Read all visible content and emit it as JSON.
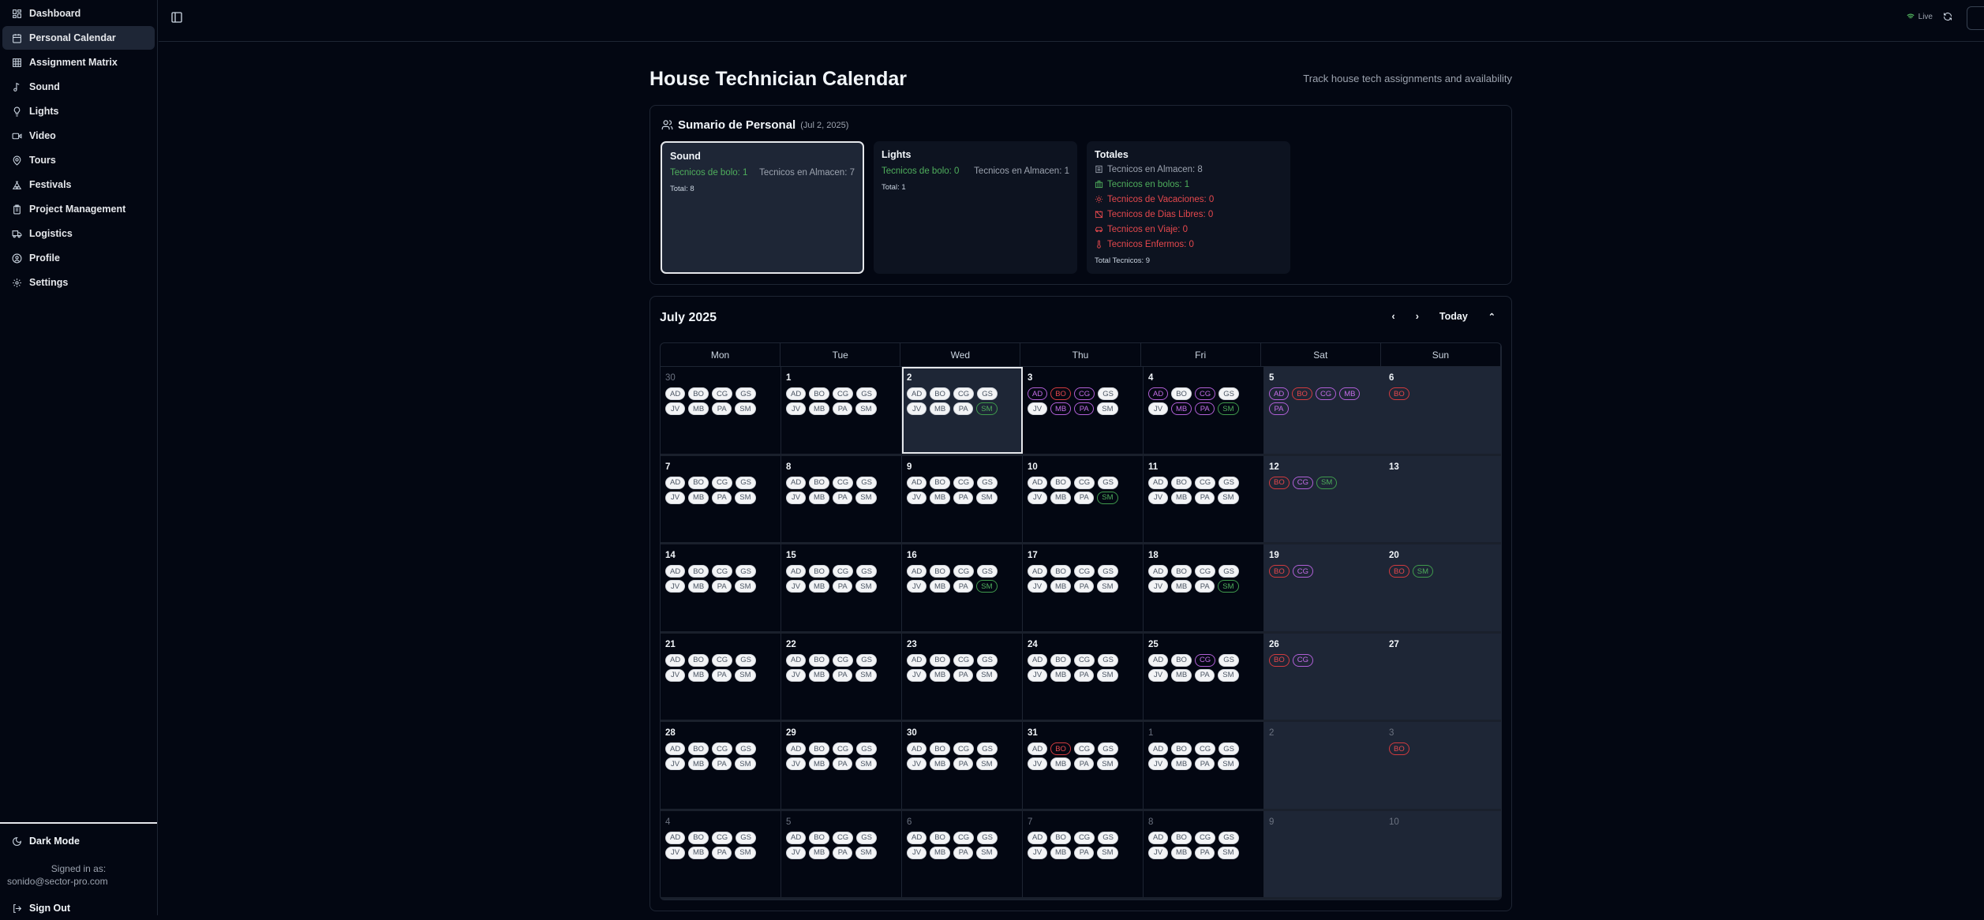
{
  "sidebar": {
    "items": [
      {
        "label": "Dashboard",
        "icon": "dashboard-icon"
      },
      {
        "label": "Personal Calendar",
        "icon": "calendar-icon",
        "active": true
      },
      {
        "label": "Assignment Matrix",
        "icon": "grid-icon"
      },
      {
        "label": "Sound",
        "icon": "music-icon"
      },
      {
        "label": "Lights",
        "icon": "lightbulb-icon"
      },
      {
        "label": "Video",
        "icon": "video-icon"
      },
      {
        "label": "Tours",
        "icon": "map-pin-icon"
      },
      {
        "label": "Festivals",
        "icon": "tent-icon"
      },
      {
        "label": "Project Management",
        "icon": "clipboard-icon"
      },
      {
        "label": "Logistics",
        "icon": "truck-icon"
      },
      {
        "label": "Profile",
        "icon": "user-circle-icon"
      },
      {
        "label": "Settings",
        "icon": "gear-icon"
      }
    ],
    "dark_mode": "Dark Mode",
    "signed_in_label": "Signed in as:",
    "email": "sonido@sector-pro.com",
    "sign_out": "Sign Out"
  },
  "topbar": {
    "live": "Live"
  },
  "page": {
    "title": "House Technician Calendar",
    "subtitle": "Track house tech assignments and availability"
  },
  "summary": {
    "title": "Sumario de Personal",
    "date": "(Jul 2, 2025)",
    "sound": {
      "title": "Sound",
      "bolo": "Tecnicos de bolo: 1",
      "almacen": "Tecnicos en Almacen: 7",
      "total": "Total: 8"
    },
    "lights": {
      "title": "Lights",
      "bolo": "Tecnicos de bolo: 0",
      "almacen": "Tecnicos en Almacen: 1",
      "total": "Total: 1"
    },
    "totales": {
      "title": "Totales",
      "almacen": "Tecnicos en Almacen: 8",
      "bolos": "Tecnicos en bolos: 1",
      "vacaciones": "Tecnicos de Vacaciones: 0",
      "dias_libres": "Tecnicos de Dias Libres: 0",
      "viaje": "Tecnicos en Viaje: 0",
      "enfermos": "Tecnicos Enfermos: 0",
      "total": "Total Tecnicos: 9"
    }
  },
  "calendar": {
    "month": "July 2025",
    "today": "Today",
    "weekdays": [
      "Mon",
      "Tue",
      "Wed",
      "Thu",
      "Fri",
      "Sat",
      "Sun"
    ],
    "default_badges": [
      "AD",
      "BO",
      "CG",
      "GS",
      "JV",
      "MB",
      "PA",
      "SM"
    ],
    "colors": {
      "purple": "#c46de8",
      "red": "#e5484d",
      "green": "#4fae5c"
    },
    "weeks": [
      [
        {
          "d": "30",
          "muted": true
        },
        {
          "d": "1"
        },
        {
          "d": "2",
          "selected": true,
          "hl": {
            "SM": "green"
          }
        },
        {
          "d": "3",
          "hl": {
            "AD": "purple",
            "BO": "red",
            "CG": "purple",
            "MB": "purple",
            "PA": "purple"
          }
        },
        {
          "d": "4",
          "hl": {
            "AD": "purple",
            "CG": "purple",
            "MB": "purple",
            "PA": "purple",
            "SM": "green"
          }
        },
        {
          "d": "5",
          "only": [
            [
              "AD",
              "purple"
            ],
            [
              "BO",
              "red"
            ],
            [
              "CG",
              "purple"
            ],
            [
              "MB",
              "purple"
            ],
            [
              "PA",
              "purple"
            ]
          ]
        },
        {
          "d": "6",
          "only": [
            [
              "BO",
              "red"
            ]
          ]
        }
      ],
      [
        {
          "d": "7"
        },
        {
          "d": "8"
        },
        {
          "d": "9"
        },
        {
          "d": "10",
          "hl": {
            "SM": "green"
          }
        },
        {
          "d": "11"
        },
        {
          "d": "12",
          "only": [
            [
              "BO",
              "red"
            ],
            [
              "CG",
              "purple"
            ],
            [
              "SM",
              "green"
            ]
          ]
        },
        {
          "d": "13",
          "only": []
        }
      ],
      [
        {
          "d": "14"
        },
        {
          "d": "15"
        },
        {
          "d": "16",
          "hl": {
            "SM": "green"
          }
        },
        {
          "d": "17"
        },
        {
          "d": "18",
          "hl": {
            "SM": "green"
          }
        },
        {
          "d": "19",
          "only": [
            [
              "BO",
              "red"
            ],
            [
              "CG",
              "purple"
            ]
          ]
        },
        {
          "d": "20",
          "only": [
            [
              "BO",
              "red"
            ],
            [
              "SM",
              "green"
            ]
          ]
        }
      ],
      [
        {
          "d": "21"
        },
        {
          "d": "22"
        },
        {
          "d": "23"
        },
        {
          "d": "24"
        },
        {
          "d": "25",
          "hl": {
            "CG": "purple"
          }
        },
        {
          "d": "26",
          "only": [
            [
              "BO",
              "red"
            ],
            [
              "CG",
              "purple"
            ]
          ]
        },
        {
          "d": "27",
          "only": []
        }
      ],
      [
        {
          "d": "28"
        },
        {
          "d": "29"
        },
        {
          "d": "30"
        },
        {
          "d": "31",
          "hl": {
            "BO": "red"
          }
        },
        {
          "d": "1",
          "muted": true
        },
        {
          "d": "2",
          "muted": true,
          "only": []
        },
        {
          "d": "3",
          "muted": true,
          "only": [
            [
              "BO",
              "red"
            ]
          ]
        }
      ],
      [
        {
          "d": "4",
          "muted": true
        },
        {
          "d": "5",
          "muted": true
        },
        {
          "d": "6",
          "muted": true
        },
        {
          "d": "7",
          "muted": true
        },
        {
          "d": "8",
          "muted": true
        },
        {
          "d": "9",
          "muted": true,
          "only": []
        },
        {
          "d": "10",
          "muted": true,
          "only": []
        }
      ]
    ]
  }
}
